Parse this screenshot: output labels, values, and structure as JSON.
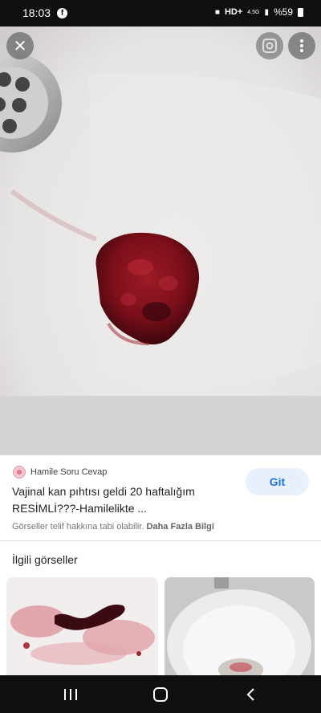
{
  "status_bar": {
    "time": "18:03",
    "right": [
      "HD+",
      "4.5G",
      "%59"
    ]
  },
  "viewer": {
    "close_icon": "close-icon",
    "lens_icon": "google-lens-icon",
    "menu_icon": "more-vert-icon"
  },
  "result": {
    "source_name": "Hamile Soru Cevap",
    "title": "Vajinal kan pıhtısı geldi 20 haftalığım RESİMLİ???-Hamilelikte ...",
    "visit_label": "Git",
    "copyright_notice": "Görseller telif hakkına tabi olabilir.",
    "more_info_label": "Daha Fazla Bilgi"
  },
  "related": {
    "heading": "İlgili görseller"
  },
  "colors": {
    "accent": "#1a73e8",
    "accent_bg": "#e8f0fe",
    "bars": "#0f0f0f"
  },
  "nav_bar": {
    "icons": [
      "recent-apps-icon",
      "home-icon",
      "back-icon"
    ]
  }
}
